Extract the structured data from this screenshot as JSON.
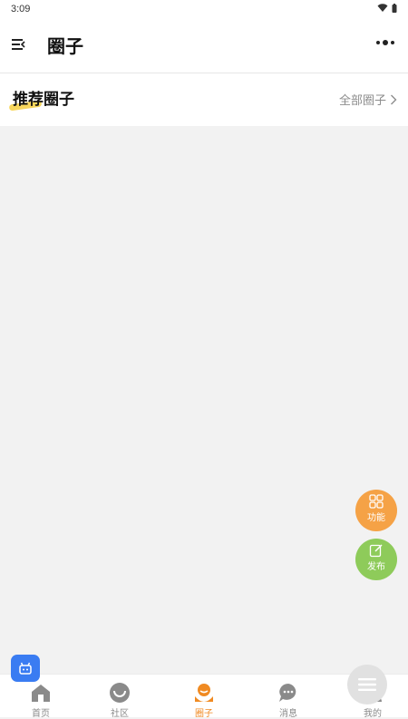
{
  "status_bar": {
    "time": "3:09"
  },
  "header": {
    "title": "圈子"
  },
  "section": {
    "title": "推荐圈子",
    "all_link": "全部圈子"
  },
  "fabs": {
    "function_label": "功能",
    "publish_label": "发布"
  },
  "tabbar": {
    "items": [
      {
        "label": "首页",
        "icon": "home-icon"
      },
      {
        "label": "社区",
        "icon": "community-icon"
      },
      {
        "label": "圈子",
        "icon": "circle-icon",
        "active": true
      },
      {
        "label": "消息",
        "icon": "message-icon"
      },
      {
        "label": "我的",
        "icon": "profile-icon"
      }
    ]
  },
  "colors": {
    "accent": "#f08a22",
    "function_fab": "#f5a246",
    "publish_fab": "#8ecb5a",
    "highlight": "#f6d24a",
    "bubble": "#3a7cf2"
  }
}
